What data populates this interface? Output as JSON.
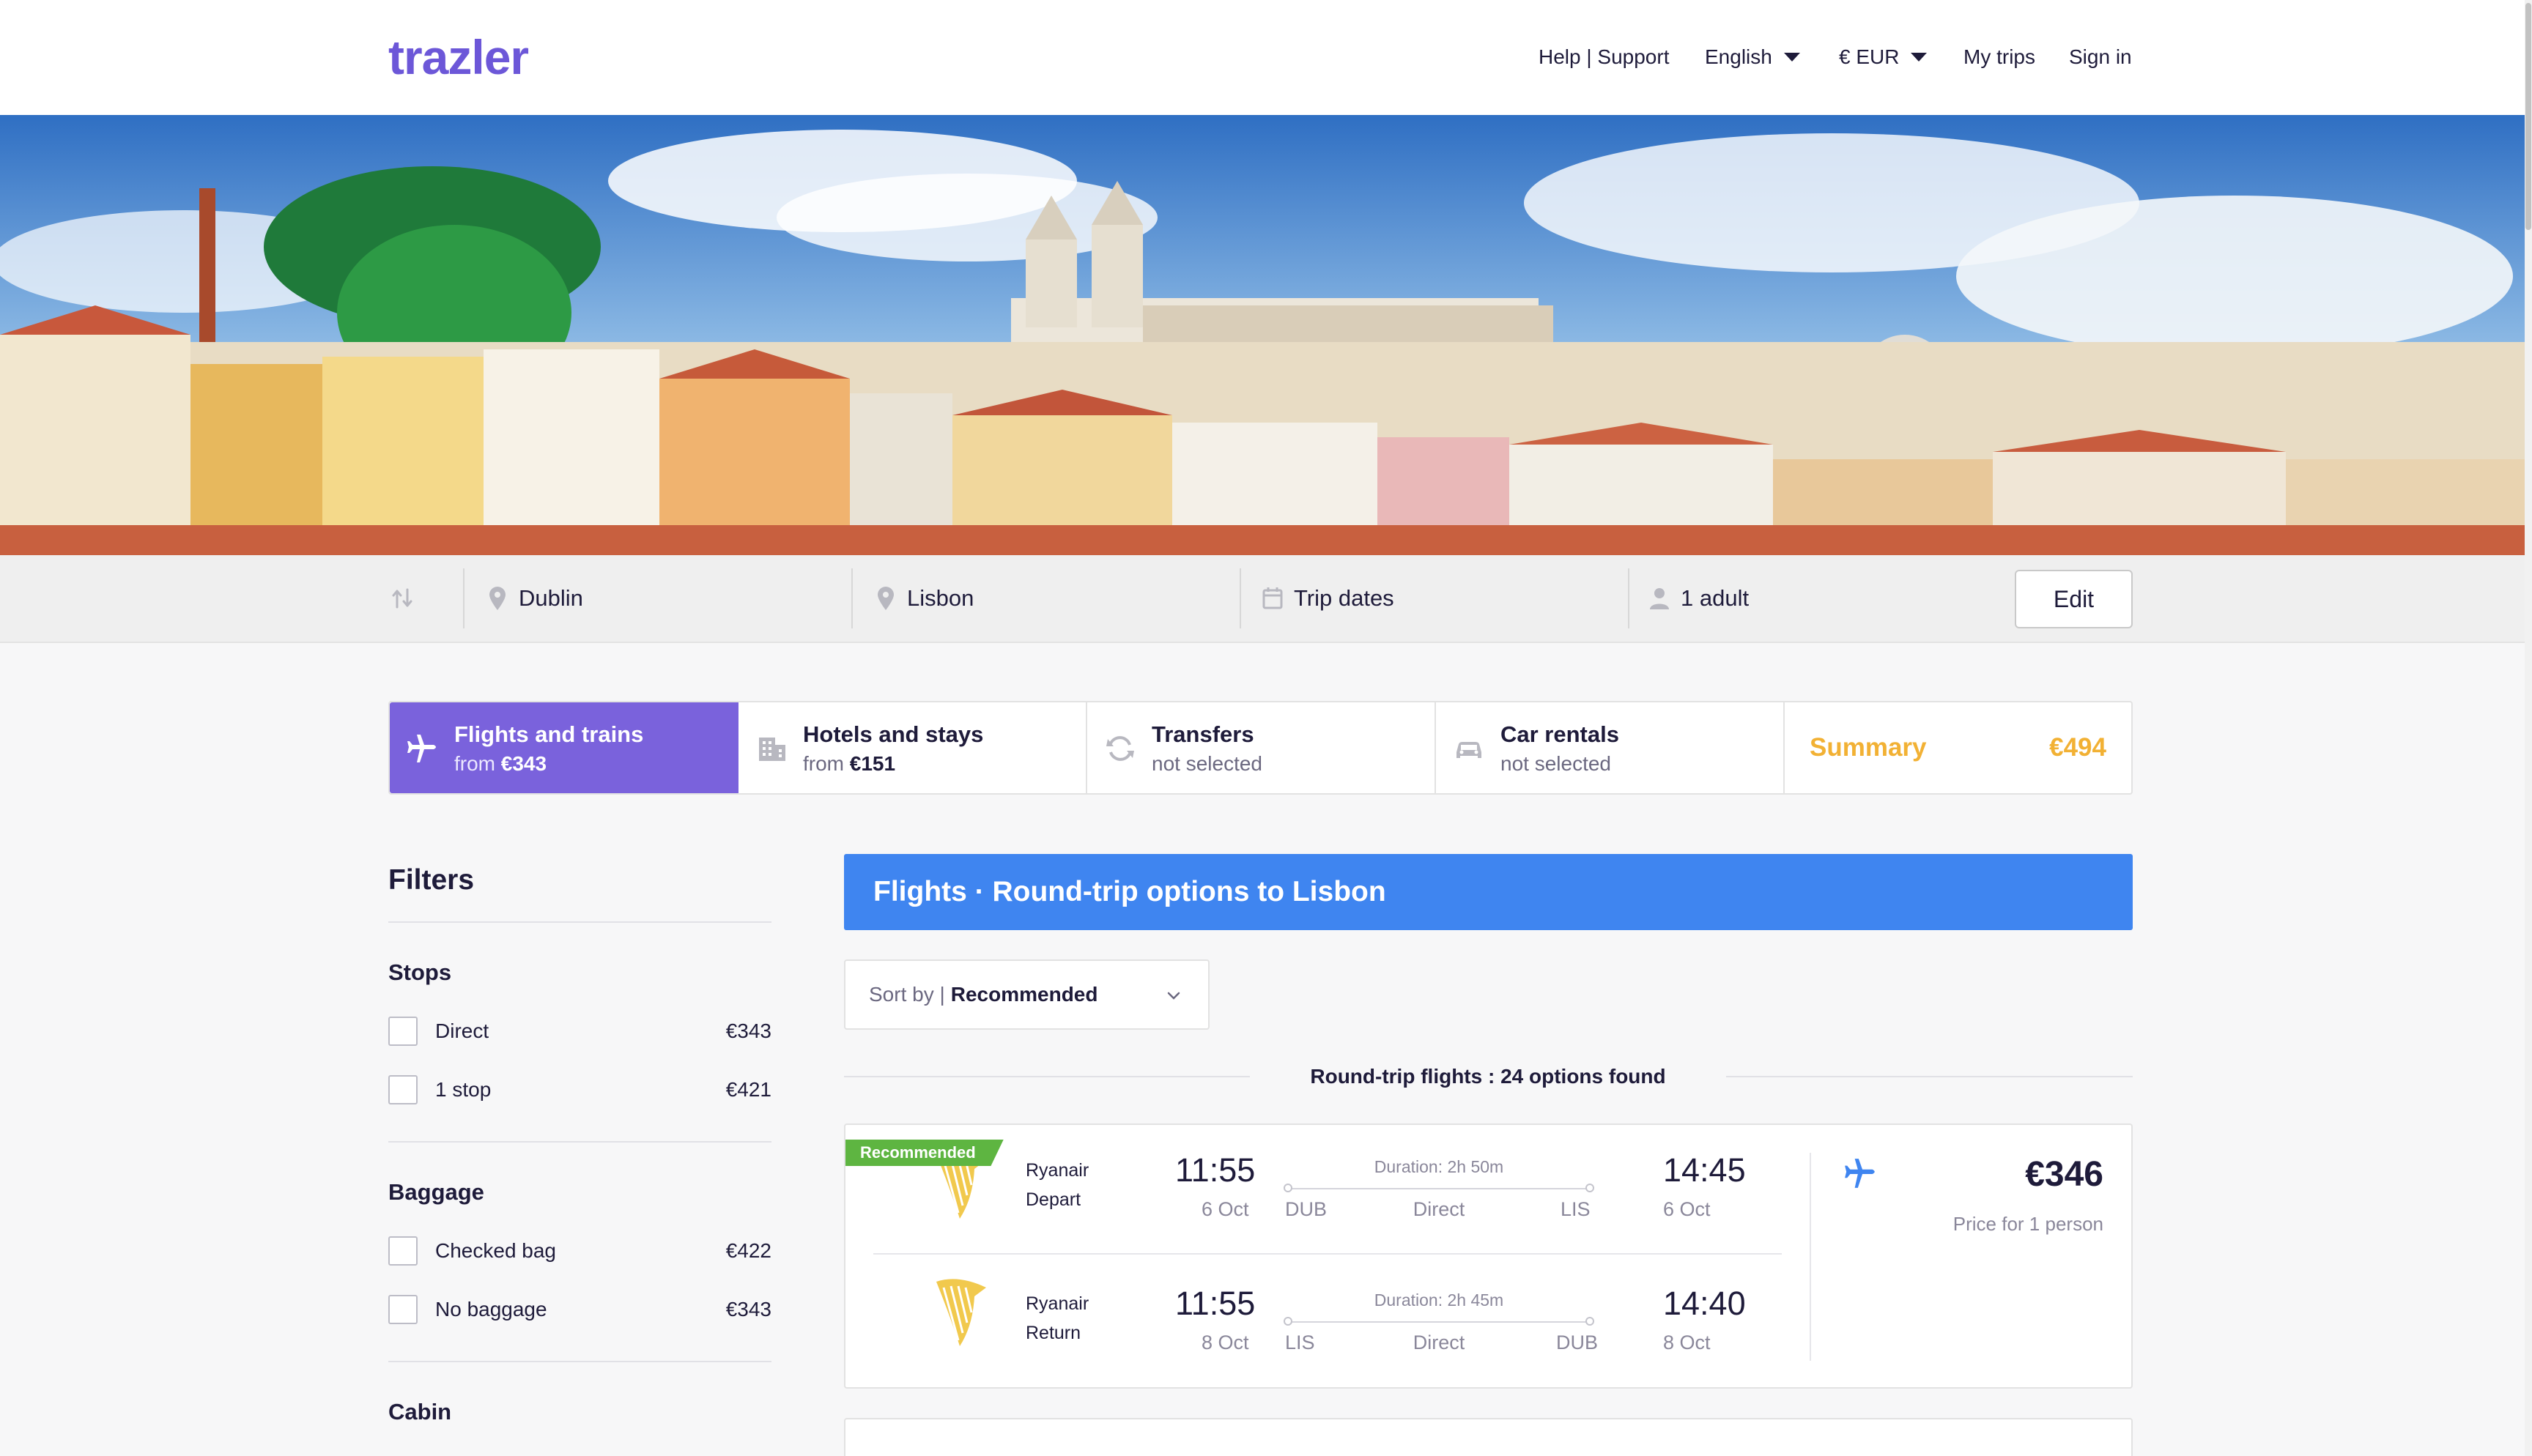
{
  "brand": {
    "logo_text": "trazler",
    "accent": "#6c57d8"
  },
  "nav": {
    "help": "Help | Support",
    "language": "English",
    "currency": "€ EUR",
    "my_trips": "My trips",
    "sign_in": "Sign in"
  },
  "search": {
    "swap_icon": "swap-icon",
    "origin": "Dublin",
    "destination": "Lisbon",
    "dates": "Trip dates",
    "travellers": "1 adult",
    "edit_label": "Edit"
  },
  "tabs": [
    {
      "title": "Flights and trains",
      "sub_prefix": "from ",
      "sub_value": "€343",
      "icon": "plane-icon"
    },
    {
      "title": "Hotels and stays",
      "sub_prefix": "from ",
      "sub_value": "€151",
      "icon": "building-icon"
    },
    {
      "title": "Transfers",
      "sub_prefix": "not selected",
      "sub_value": "",
      "icon": "refresh-icon"
    },
    {
      "title": "Car rentals",
      "sub_prefix": "not selected",
      "sub_value": "",
      "icon": "car-icon"
    }
  ],
  "summary": {
    "label": "Summary",
    "price": "€494",
    "color": "#f2b134"
  },
  "filters": {
    "title": "Filters",
    "stops": {
      "heading": "Stops",
      "options": [
        {
          "label": "Direct",
          "price": "€343"
        },
        {
          "label": "1 stop",
          "price": "€421"
        }
      ]
    },
    "baggage": {
      "heading": "Baggage",
      "options": [
        {
          "label": "Checked bag",
          "price": "€422"
        },
        {
          "label": "No baggage",
          "price": "€343"
        }
      ]
    },
    "cabin": {
      "heading": "Cabin"
    }
  },
  "results": {
    "header": "Flights · Round-trip options to Lisbon",
    "header_color": "#3f85f0",
    "sort_prefix": "Sort by |",
    "sort_value": "Recommended",
    "count_text": "Round-trip flights : 24 options found"
  },
  "flights": [
    {
      "badge": "Recommended",
      "price": "€346",
      "price_note": "Price for 1 person",
      "legs": [
        {
          "airline": "Ryanair",
          "direction": "Depart",
          "dep_time": "11:55",
          "dep_date": "6 Oct",
          "duration": "Duration: 2h 50m",
          "from": "DUB",
          "stops": "Direct",
          "to": "LIS",
          "arr_time": "14:45",
          "arr_date": "6 Oct"
        },
        {
          "airline": "Ryanair",
          "direction": "Return",
          "dep_time": "11:55",
          "dep_date": "8 Oct",
          "duration": "Duration: 2h 45m",
          "from": "LIS",
          "stops": "Direct",
          "to": "DUB",
          "arr_time": "14:40",
          "arr_date": "8 Oct"
        }
      ]
    }
  ]
}
